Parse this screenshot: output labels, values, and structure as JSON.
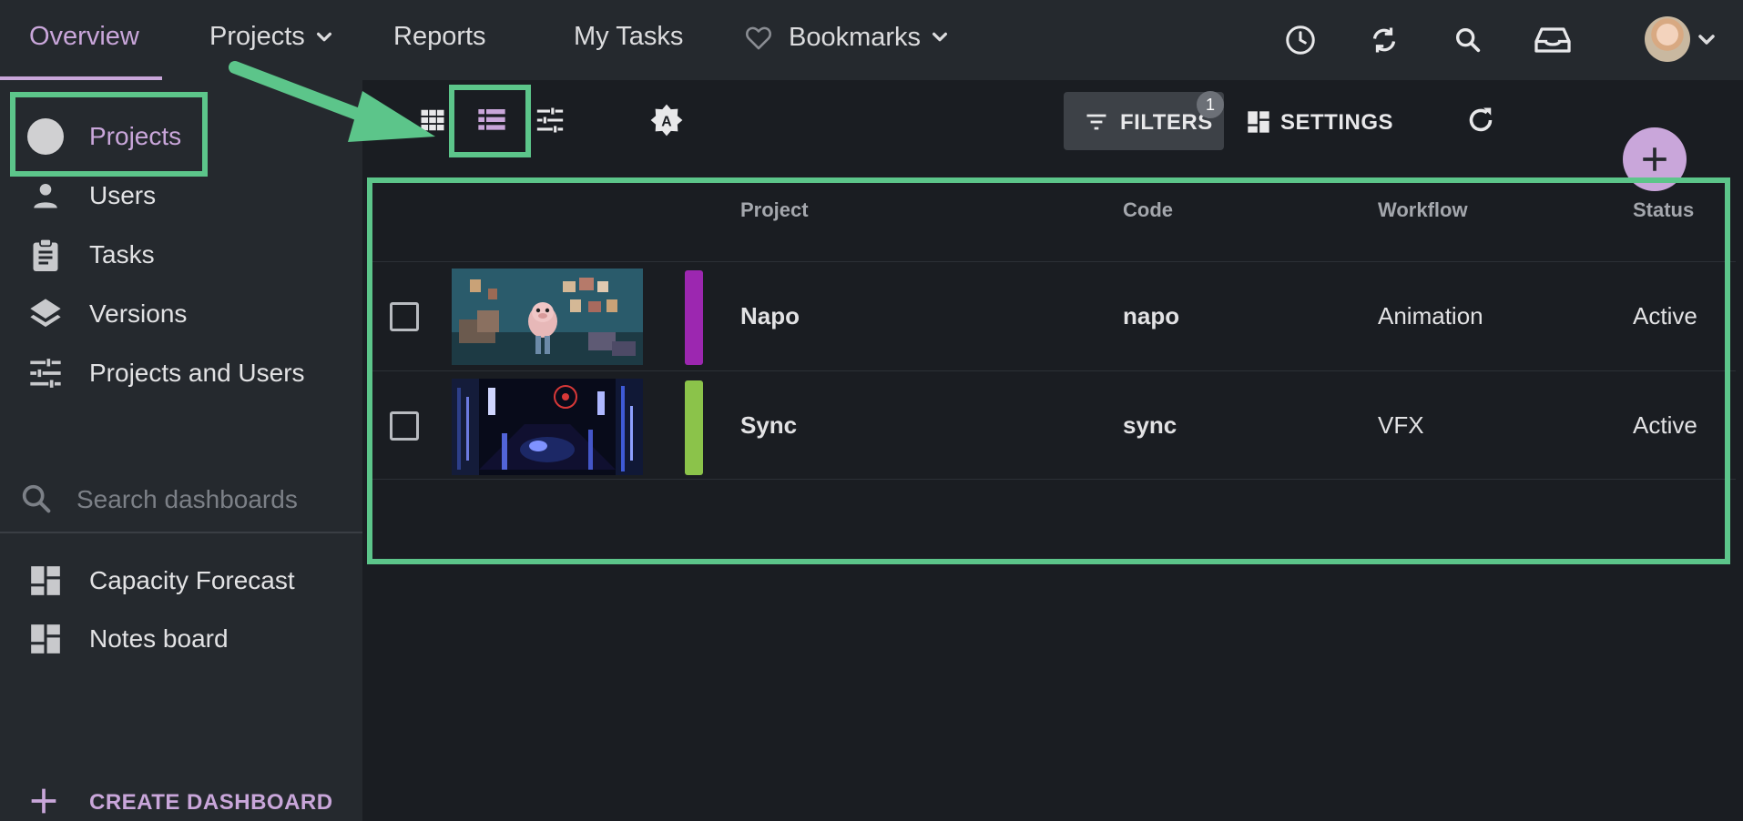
{
  "topnav": {
    "items": [
      {
        "label": "Overview",
        "active": true
      },
      {
        "label": "Projects",
        "dropdown": true
      },
      {
        "label": "Reports"
      },
      {
        "label": "My Tasks"
      },
      {
        "label": "Bookmarks",
        "dropdown": true,
        "icon": "heart-icon"
      }
    ],
    "right_icons": [
      "clock-icon",
      "sync-icon",
      "search-icon",
      "inbox-icon"
    ],
    "avatar": "user-avatar"
  },
  "sidebar": {
    "items": [
      {
        "label": "Projects",
        "icon": "project-circle-icon",
        "active": true
      },
      {
        "label": "Users",
        "icon": "person-icon"
      },
      {
        "label": "Tasks",
        "icon": "clipboard-icon"
      },
      {
        "label": "Versions",
        "icon": "layers-icon"
      },
      {
        "label": "Projects and Users",
        "icon": "sliders-icon"
      }
    ],
    "search_placeholder": "Search dashboards",
    "dashboards": [
      {
        "label": "Capacity Forecast",
        "icon": "dashboard-icon"
      },
      {
        "label": "Notes board",
        "icon": "dashboard-icon"
      }
    ],
    "create_label": "CREATE DASHBOARD"
  },
  "toolbar": {
    "view_icons": [
      "grid-view-icon",
      "list-view-icon",
      "tune-icon",
      "auto-theme-icon"
    ],
    "filters_label": "FILTERS",
    "filters_count": "1",
    "settings_label": "SETTINGS",
    "refresh_icon": "refresh-icon",
    "add_icon": "plus-icon"
  },
  "table": {
    "columns": [
      "Project",
      "Code",
      "Workflow",
      "Status"
    ],
    "rows": [
      {
        "project": "Napo",
        "code": "napo",
        "workflow": "Animation",
        "status": "Active",
        "color": "#9c27b0"
      },
      {
        "project": "Sync",
        "code": "sync",
        "workflow": "VFX",
        "status": "Active",
        "color": "#8bc34a"
      }
    ]
  },
  "colors": {
    "accent": "#c9a6da",
    "highlight": "#5cc58a",
    "topbar": "#25292e",
    "background": "#1a1d22"
  }
}
